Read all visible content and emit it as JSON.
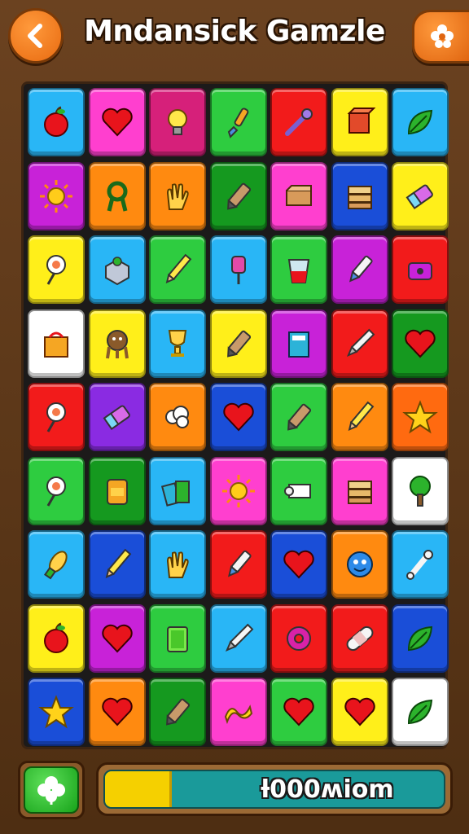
{
  "header": {
    "title": "Mndansick Gamzle",
    "back_icon": "chevron-left-icon",
    "settings_icon": "flower-icon"
  },
  "board": {
    "rows": 9,
    "cols": 7,
    "tiles": [
      [
        "#29b6f6",
        "apple-icon"
      ],
      [
        "#ff3fcf",
        "heart-icon"
      ],
      [
        "#d6207a",
        "lightbulb-icon"
      ],
      [
        "#2ecc40",
        "brush-icon"
      ],
      [
        "#f21b1b",
        "tool-icon"
      ],
      [
        "#ffef1a",
        "cube-icon"
      ],
      [
        "#29b6f6",
        "leaf-icon"
      ],
      [
        "#c822d8",
        "sun-icon"
      ],
      [
        "#ff8a10",
        "ribbon-icon"
      ],
      [
        "#ff8a10",
        "hand-icon"
      ],
      [
        "#15991f",
        "crayon-icon"
      ],
      [
        "#ff3fcf",
        "box-icon"
      ],
      [
        "#1a4ed8",
        "stack-icon"
      ],
      [
        "#ffef1a",
        "eraser-icon"
      ],
      [
        "#ffef1a",
        "lollipop-icon"
      ],
      [
        "#29b6f6",
        "block-icon"
      ],
      [
        "#2ecc40",
        "pencil-icon"
      ],
      [
        "#29b6f6",
        "pin-icon"
      ],
      [
        "#2ecc40",
        "cup-icon"
      ],
      [
        "#c822d8",
        "marker-icon"
      ],
      [
        "#f21b1b",
        "sharpener-icon"
      ],
      [
        "#ffffff",
        "bag-icon"
      ],
      [
        "#ffef1a",
        "creature-icon"
      ],
      [
        "#29b6f6",
        "trophy-icon"
      ],
      [
        "#ffef1a",
        "crayon-icon"
      ],
      [
        "#c822d8",
        "book-icon"
      ],
      [
        "#f21b1b",
        "pen-icon"
      ],
      [
        "#15991f",
        "heart-icon"
      ],
      [
        "#f21b1b",
        "lollipop-icon"
      ],
      [
        "#8a2be2",
        "eraser-icon"
      ],
      [
        "#ff8a10",
        "cloud-icon"
      ],
      [
        "#1a4ed8",
        "heart-icon"
      ],
      [
        "#2ecc40",
        "crayon-icon"
      ],
      [
        "#ff8a10",
        "pencil-icon"
      ],
      [
        "#ff6a10",
        "star-icon"
      ],
      [
        "#2ecc40",
        "lollipop-icon"
      ],
      [
        "#15991f",
        "jar-icon"
      ],
      [
        "#29b6f6",
        "books-icon"
      ],
      [
        "#ff3fcf",
        "sun-icon"
      ],
      [
        "#2ecc40",
        "scroll-icon"
      ],
      [
        "#ff3fcf",
        "stack-icon"
      ],
      [
        "#ffffff",
        "tree-icon"
      ],
      [
        "#29b6f6",
        "corn-icon"
      ],
      [
        "#1a4ed8",
        "pencil-icon"
      ],
      [
        "#29b6f6",
        "hand-icon"
      ],
      [
        "#f21b1b",
        "marker-icon"
      ],
      [
        "#1a4ed8",
        "heart-icon"
      ],
      [
        "#ff8a10",
        "face-icon"
      ],
      [
        "#29b6f6",
        "bone-icon"
      ],
      [
        "#ffef1a",
        "apple-icon"
      ],
      [
        "#c822d8",
        "heart-icon"
      ],
      [
        "#2ecc40",
        "card-icon"
      ],
      [
        "#29b6f6",
        "pen-icon"
      ],
      [
        "#f21b1b",
        "donut-icon"
      ],
      [
        "#f21b1b",
        "bandage-icon"
      ],
      [
        "#1a4ed8",
        "leaf-icon"
      ],
      [
        "#1a4ed8",
        "star-icon"
      ],
      [
        "#ff8a10",
        "heart-icon"
      ],
      [
        "#15991f",
        "crayon-icon"
      ],
      [
        "#ff3fcf",
        "wave-icon"
      ],
      [
        "#2ecc40",
        "heart-icon"
      ],
      [
        "#ffef1a",
        "heart-icon"
      ],
      [
        "#ffffff",
        "leaf-icon"
      ]
    ]
  },
  "footer": {
    "clover_icon": "clover-icon",
    "progress_label": "ƚ000ʍiom",
    "progress_fraction": 0.19,
    "colors": {
      "fill": "#f5d000",
      "track": "#1a9a9a"
    }
  }
}
